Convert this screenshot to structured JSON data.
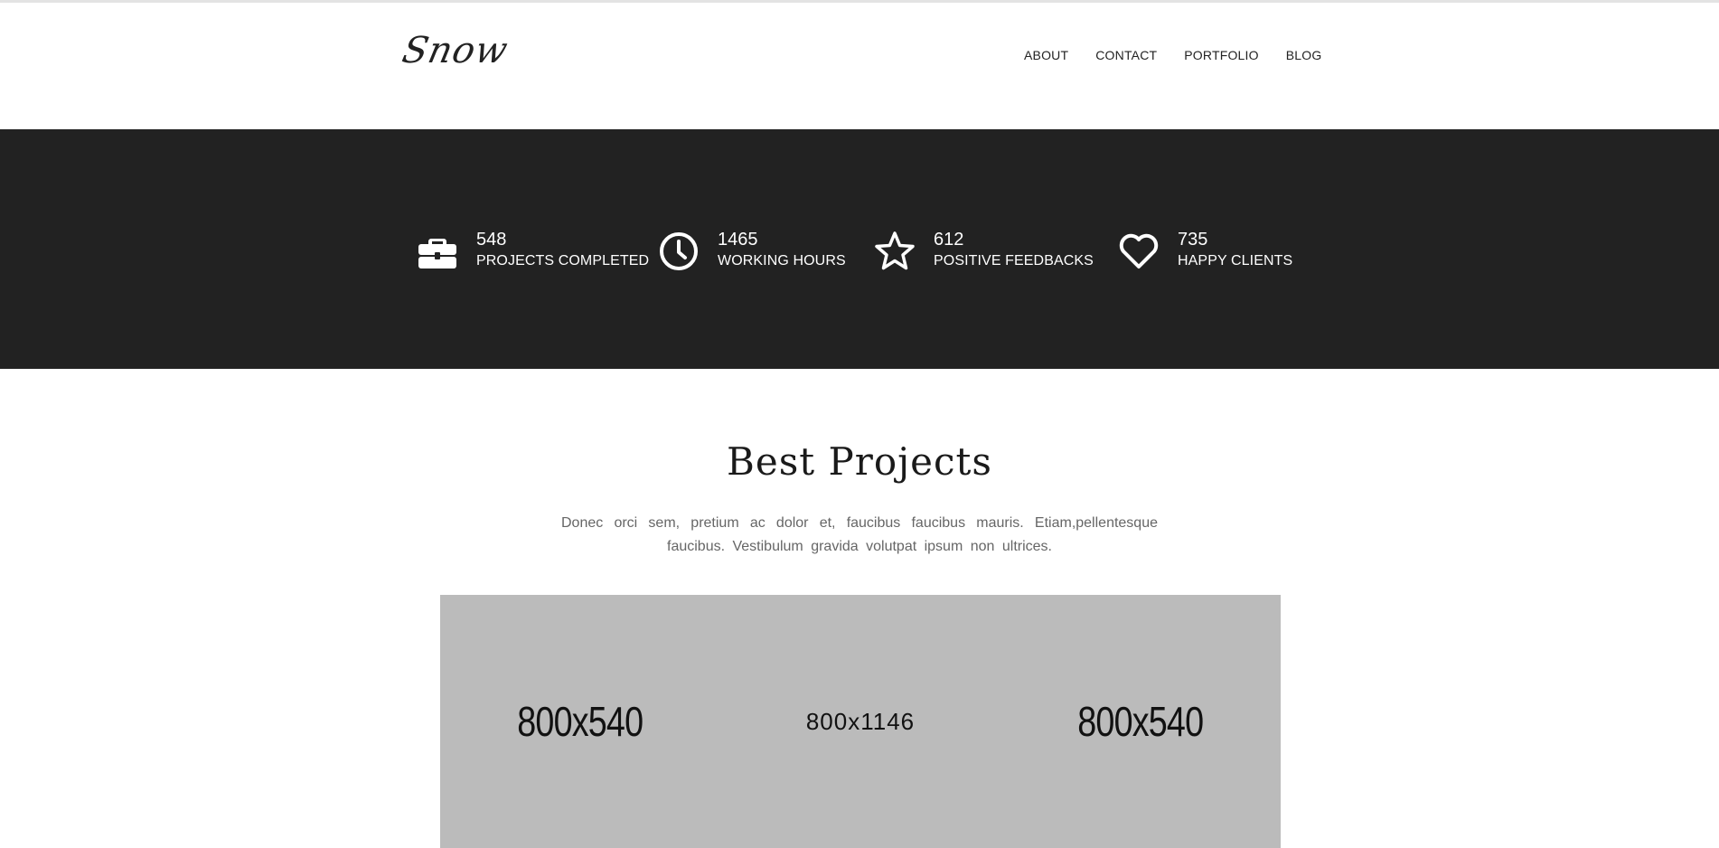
{
  "header": {
    "logo_text": "Snow",
    "nav": [
      {
        "label": "ABOUT"
      },
      {
        "label": "CONTACT"
      },
      {
        "label": "PORTFOLIO"
      },
      {
        "label": "BLOG"
      }
    ]
  },
  "stats": [
    {
      "icon": "briefcase-icon",
      "value": "548",
      "label": "PROJECTS COMPLETED"
    },
    {
      "icon": "clock-icon",
      "value": "1465",
      "label": "WORKING HOURS"
    },
    {
      "icon": "star-icon",
      "value": "612",
      "label": "POSITIVE FEEDBACKS"
    },
    {
      "icon": "heart-icon",
      "value": "735",
      "label": "HAPPY CLIENTS"
    }
  ],
  "projects": {
    "title": "Best Projects",
    "description": "Donec orci sem, pretium ac dolor et, faucibus faucibus mauris. Etiam,pellentesque faucibus. Vestibulum gravida volutpat ipsum non ultrices.",
    "thumbnails": [
      {
        "label": "800x540"
      },
      {
        "label": "800x1146"
      },
      {
        "label": "800x540"
      }
    ]
  },
  "colors": {
    "stats_background": "#222222",
    "gallery_placeholder": "#bbbbbb",
    "text_dark": "#222222"
  }
}
